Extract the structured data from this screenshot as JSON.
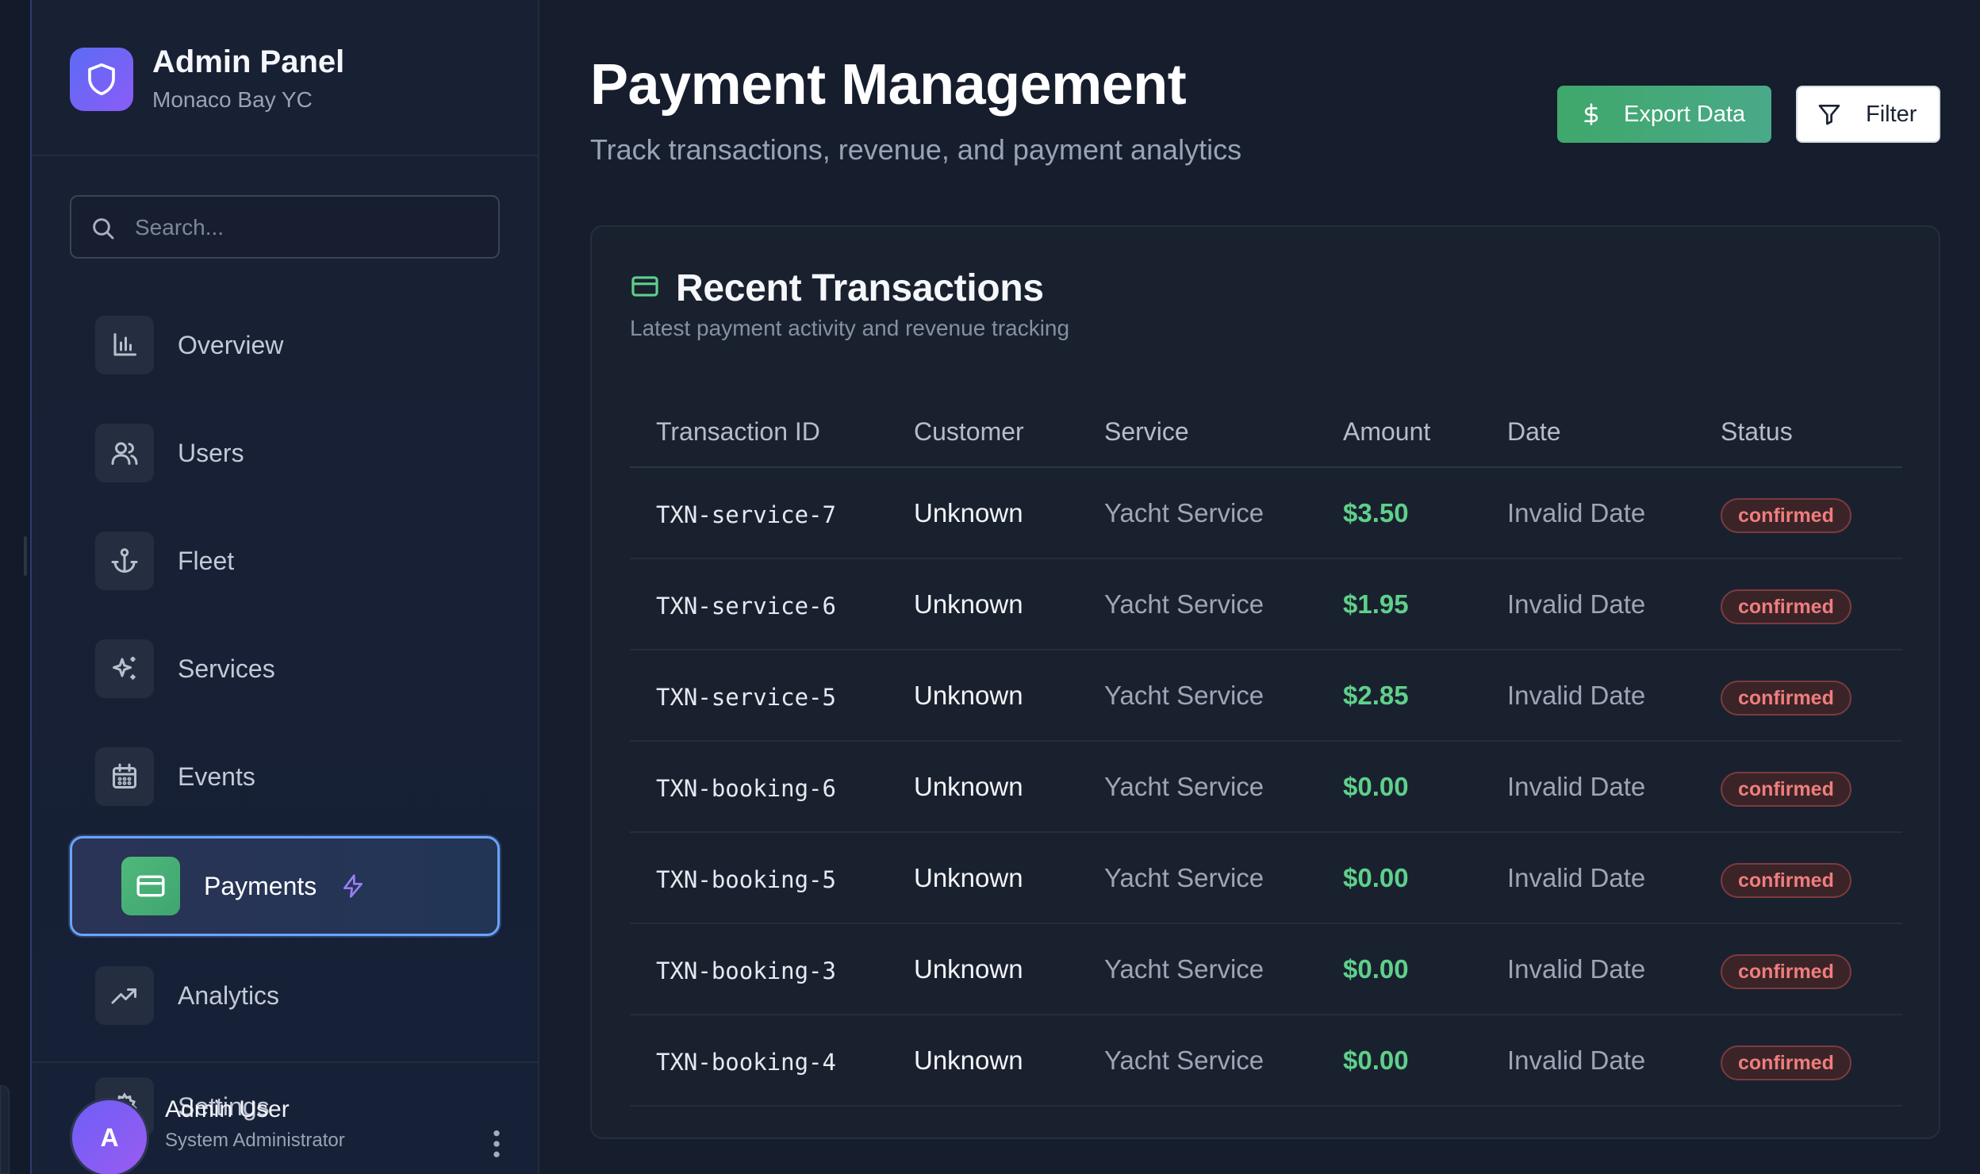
{
  "sidebar": {
    "brand_title": "Admin Panel",
    "brand_subtitle": "Monaco Bay YC",
    "search_placeholder": "Search...",
    "items": [
      {
        "label": "Overview",
        "icon": "bar-chart-icon"
      },
      {
        "label": "Users",
        "icon": "users-icon"
      },
      {
        "label": "Fleet",
        "icon": "anchor-icon"
      },
      {
        "label": "Services",
        "icon": "sparkles-icon"
      },
      {
        "label": "Events",
        "icon": "calendar-icon"
      },
      {
        "label": "Payments",
        "icon": "credit-card-icon",
        "active": true
      },
      {
        "label": "Analytics",
        "icon": "trending-up-icon"
      },
      {
        "label": "Settings",
        "icon": "gear-icon"
      }
    ],
    "user": {
      "initial": "A",
      "name": "Admin User",
      "role": "System Administrator"
    }
  },
  "header": {
    "title": "Payment Management",
    "subtitle": "Track transactions, revenue, and payment analytics",
    "export_label": "Export Data",
    "filter_label": "Filter"
  },
  "transactions": {
    "title": "Recent Transactions",
    "subtitle": "Latest payment activity and revenue tracking",
    "columns": [
      "Transaction ID",
      "Customer",
      "Service",
      "Amount",
      "Date",
      "Status"
    ],
    "rows": [
      {
        "id": "TXN-service-7",
        "customer": "Unknown",
        "service": "Yacht Service",
        "amount": "$3.50",
        "date": "Invalid Date",
        "status": "confirmed"
      },
      {
        "id": "TXN-service-6",
        "customer": "Unknown",
        "service": "Yacht Service",
        "amount": "$1.95",
        "date": "Invalid Date",
        "status": "confirmed"
      },
      {
        "id": "TXN-service-5",
        "customer": "Unknown",
        "service": "Yacht Service",
        "amount": "$2.85",
        "date": "Invalid Date",
        "status": "confirmed"
      },
      {
        "id": "TXN-booking-6",
        "customer": "Unknown",
        "service": "Yacht Service",
        "amount": "$0.00",
        "date": "Invalid Date",
        "status": "confirmed"
      },
      {
        "id": "TXN-booking-5",
        "customer": "Unknown",
        "service": "Yacht Service",
        "amount": "$0.00",
        "date": "Invalid Date",
        "status": "confirmed"
      },
      {
        "id": "TXN-booking-3",
        "customer": "Unknown",
        "service": "Yacht Service",
        "amount": "$0.00",
        "date": "Invalid Date",
        "status": "confirmed"
      },
      {
        "id": "TXN-booking-4",
        "customer": "Unknown",
        "service": "Yacht Service",
        "amount": "$0.00",
        "date": "Invalid Date",
        "status": "confirmed"
      }
    ]
  },
  "colors": {
    "accent_green": "#4aa97a",
    "amount_green": "#5fd08a",
    "status_red": "#f07d7d",
    "active_border": "#6aa4ff",
    "brand_purple": "#7a63f5"
  }
}
